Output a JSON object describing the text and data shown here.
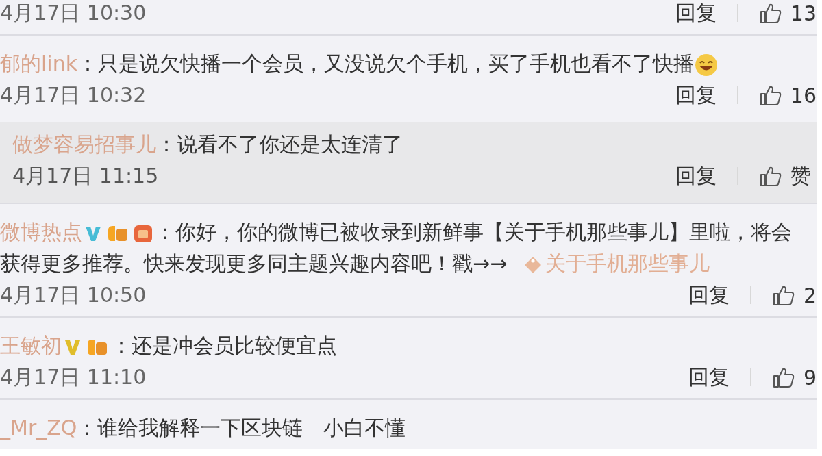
{
  "comments": [
    {
      "kind": "comment",
      "date": "4月17日 10:30",
      "reply": "回复",
      "likes": "13"
    },
    {
      "kind": "comment",
      "username": "郁的link",
      "text": "：只是说欠快播一个会员，又没说欠个手机，买了手机也看不了快播",
      "emoji": true,
      "date": "4月17日 10:32",
      "reply": "回复",
      "likes": "16",
      "replies": [
        {
          "kind": "reply",
          "username": "做梦容易招事儿",
          "text": "：说看不了你还是太连清了",
          "date": "4月17日 11:15",
          "reply": "回复",
          "likes": "赞"
        }
      ]
    },
    {
      "kind": "comment",
      "username": "微博热点",
      "badges": [
        {
          "kind": "verified"
        },
        {
          "kind": "level"
        },
        {
          "kind": "medal"
        }
      ],
      "text": "：你好，你的微博已被收录到新鲜事【关于手机那些事儿】里啦，将会",
      "text_more": "获得更多推荐。快来发现更多同主题兴趣内容吧！戳→→",
      "link": "关于手机那些事儿",
      "date": "4月17日 10:50",
      "reply": "回复",
      "likes": "2"
    },
    {
      "kind": "comment",
      "username": "王敏初",
      "badges": [
        {
          "kind": "verified_gold"
        },
        {
          "kind": "level"
        }
      ],
      "text": "：还是冲会员比较便宜点",
      "date": "4月17日 11:10",
      "reply": "回复",
      "likes": "9"
    },
    {
      "kind": "comment",
      "username": "_Mr_ZQ",
      "text": "：谁给我解释一下区块链　小白不懂"
    }
  ]
}
